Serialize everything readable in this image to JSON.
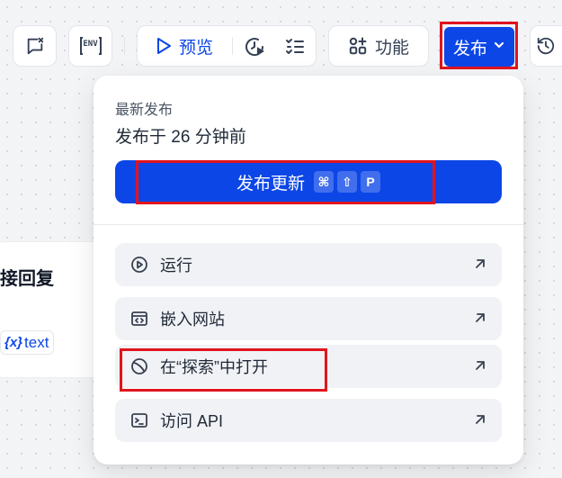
{
  "toolbar": {
    "preview_label": "预览",
    "features_label": "功能",
    "env_label": "ENV",
    "publish_label": "发布"
  },
  "node": {
    "title": "接回复",
    "var_chip": "text",
    "var_symbol": "{x}"
  },
  "publish_panel": {
    "heading": "最新发布",
    "time_text": "发布于 26 分钟前",
    "update_button": {
      "label": "发布更新",
      "shortcut": [
        "⌘",
        "⇧",
        "P"
      ]
    },
    "items": [
      {
        "label": "运行",
        "icon": "play-circle-icon"
      },
      {
        "label": "嵌入网站",
        "icon": "embed-code-icon"
      },
      {
        "label": "在“探索”中打开",
        "icon": "compass-icon"
      },
      {
        "label": "访问 API",
        "icon": "terminal-icon"
      }
    ]
  },
  "colors": {
    "accent": "#0c46e7",
    "highlight_box": "#e0141e",
    "item_bg": "#f1f2f5"
  }
}
